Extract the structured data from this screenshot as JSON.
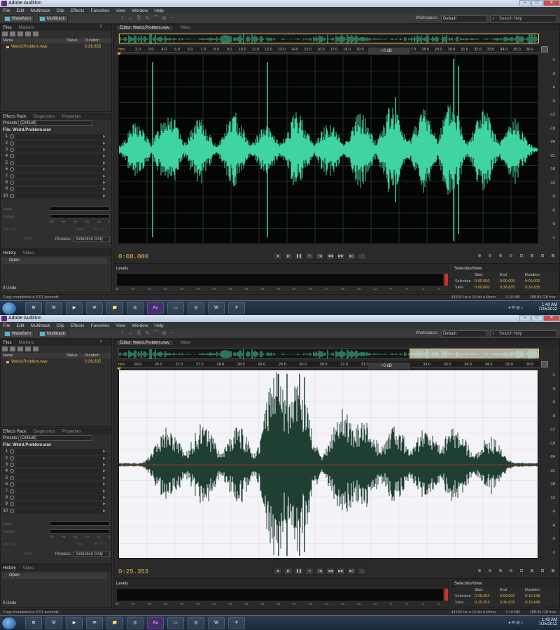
{
  "colors": {
    "accent": "#e7b64a",
    "wave_green": "#3fd4a0",
    "wave_dark": "#1f3f33",
    "grid_dark": "#2a5a32",
    "centerline": "#c0392b",
    "peak_red": "#d12d2d"
  },
  "app": {
    "title": "Adobe Audition",
    "window_controls": [
      "–",
      "□",
      "✕"
    ]
  },
  "menu": [
    "File",
    "Edit",
    "Multitrack",
    "Clip",
    "Effects",
    "Favorites",
    "View",
    "Window",
    "Help"
  ],
  "toolbar": {
    "waveform_label": "Waveform",
    "multitrack_label": "Multitrack",
    "workspace_label": "Workspace:",
    "workspace_value": "Default",
    "search_placeholder": "Search Help",
    "tools": [
      "I",
      "↔",
      "⎘",
      "✎",
      "⌒",
      "⊘",
      "⋯"
    ]
  },
  "files_panel": {
    "tabs": [
      "Files",
      "Markers"
    ],
    "columns": {
      "name": "Name",
      "status": "Status",
      "duration": "Duration"
    },
    "file": {
      "name": "Weird.Problem.wav",
      "duration": "0:36.835"
    }
  },
  "effects_panel": {
    "tabs": [
      "Effects Rack",
      "Diagnostics",
      "Properties"
    ],
    "presets_label": "Presets:",
    "presets_value": "(Default)",
    "file_label": "File: Weird.Problem.wav",
    "slots": [
      "1",
      "2",
      "3",
      "4",
      "5",
      "6",
      "7",
      "8",
      "9",
      "10"
    ],
    "input_label": "Input:",
    "output_label": "Output:",
    "mix_label": "Mix:",
    "mix_dry": "Dry",
    "mix_wet": "Wet",
    "mix_pct": "100 %",
    "apply_label": "Apply",
    "process_label": "Process:",
    "process_value": "Selection Only",
    "meter_scale": [
      "dB",
      "-48",
      "-36",
      "-24",
      "-12",
      "0"
    ]
  },
  "history_panel": {
    "tabs": [
      "History",
      "Video"
    ],
    "item": "Open",
    "undo": "0 Undo"
  },
  "editor": {
    "tabs": [
      "Editor: Weird.Problem.wav",
      "Mixer"
    ],
    "hud_db": "+0 dB",
    "ruler_unit": "hms"
  },
  "levels": {
    "title": "Levels",
    "scale": [
      "dB",
      "-57",
      "-54",
      "-51",
      "-48",
      "-45",
      "-42",
      "-39",
      "-36",
      "-33",
      "-30",
      "-27",
      "-24",
      "-21",
      "-18",
      "-15",
      "-12",
      "-9",
      "-6",
      "-3",
      "0"
    ]
  },
  "selview": {
    "title": "Selection/View",
    "col_start": "Start",
    "col_end": "End",
    "col_duration": "Duration",
    "row_selection": "Selection",
    "row_view": "View"
  },
  "status": {
    "left": "Copy completed in 0.01 seconds",
    "fmt": "44100 Hz ● 16-bit ● Mono",
    "size": "3.10 MB",
    "free": "188.86 GB free"
  },
  "taskbar": {
    "apps": [
      "⚙",
      "M",
      "▶",
      "✉",
      "📁",
      "◎",
      "Au",
      "▭",
      "◎",
      "W",
      "✈"
    ],
    "date": "7/25/2012"
  },
  "shots": [
    {
      "id": "A",
      "ruler_ticks": [
        "2.0",
        "3.0",
        "4.0",
        "5.0",
        "6.0",
        "7.0",
        "8.0",
        "9.0",
        "10.0",
        "11.0",
        "12.0",
        "13.0",
        "14.0",
        "15.0",
        "16.0",
        "17.0",
        "18.0",
        "19.0",
        "20.0",
        "21.0",
        "22",
        "27.0",
        "28.0",
        "29.0",
        "30.0",
        "31.0",
        "32.0",
        "33.0",
        "34.0",
        "35.0",
        "36.0"
      ],
      "db_labels": [
        "-1",
        "-3",
        "-6",
        "-9",
        "-12",
        "-18",
        "-24",
        "-21",
        "-18",
        "-12",
        "-9",
        "-6",
        "-3",
        "-1"
      ],
      "timecode": "0:00.000",
      "clock": "1:40 AM",
      "sel_start": "0:00.000",
      "sel_end": "0:00.000",
      "sel_dur": "0:00.000",
      "view_start": "0:00.000",
      "view_end": "0:36.835",
      "view_dur": "0:36.835"
    },
    {
      "id": "B",
      "ruler_ticks": [
        "26.0",
        "26.5",
        "27.0",
        "27.5",
        "28.0",
        "28.5",
        "29.0",
        "29.5",
        "30.0",
        "30.5",
        "31.0",
        "31.5",
        "32.0",
        "32.5",
        "33.0",
        "33.5",
        "34.0",
        "34.5",
        "35.0",
        "35.5"
      ],
      "db_labels": [
        "-1",
        "-3",
        "-6",
        "-9",
        "-12",
        "-18",
        "-24",
        "-21",
        "-18",
        "-12",
        "-9",
        "-6",
        "-3",
        "-1"
      ],
      "timecode": "0:25.353",
      "clock": "1:42 AM",
      "sel_start": "0:25.353",
      "sel_end": "0:00.000",
      "sel_dur": "0:10.648",
      "view_start": "0:25.353",
      "view_end": "0:36.835",
      "view_dur": "0:10.648"
    }
  ]
}
